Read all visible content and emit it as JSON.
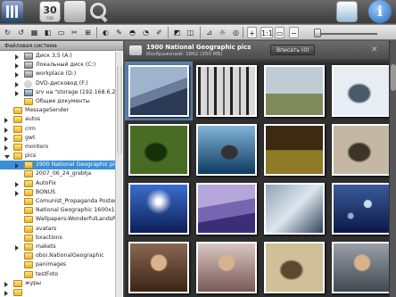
{
  "toolbar": {
    "calendar_day": "30",
    "calendar_month": "FEB",
    "info_glyph": "i",
    "buttons": [
      "↻",
      "↺",
      "▦",
      "◧",
      "▭",
      "✂",
      "⊞",
      "◐",
      "✎",
      "◓",
      "◔",
      "✐",
      "◩",
      "◫",
      "⊿",
      "☼",
      "◎",
      "+",
      "1:1",
      "▭",
      "−"
    ]
  },
  "left_panel": {
    "header": "Файловая система",
    "tree": [
      {
        "label": "Диск 3,5 (A:)",
        "icon": "drive",
        "level": 1,
        "expander": "closed"
      },
      {
        "label": "Локальный диск (C:)",
        "icon": "drive",
        "level": 1,
        "expander": "closed"
      },
      {
        "label": "workplace (D:)",
        "icon": "drive",
        "level": 1,
        "expander": "closed"
      },
      {
        "label": "DVD-дисковод (F:)",
        "icon": "cd",
        "level": 1,
        "expander": "closed"
      },
      {
        "label": "srv на \"storage (192.168.6.2)\"",
        "icon": "net",
        "level": 1,
        "expander": "closed"
      },
      {
        "label": "Общие документы",
        "icon": "folder",
        "level": 1,
        "expander": "none"
      },
      {
        "label": "MessageSender",
        "icon": "folder",
        "level": 0,
        "expander": "none"
      },
      {
        "label": "autos",
        "icon": "folder",
        "level": 0,
        "expander": "closed"
      },
      {
        "label": "crm",
        "icon": "folder",
        "level": 0,
        "expander": "closed"
      },
      {
        "label": "gwt",
        "icon": "folder",
        "level": 0,
        "expander": "closed"
      },
      {
        "label": "montero",
        "icon": "folder",
        "level": 0,
        "expander": "closed"
      },
      {
        "label": "pics",
        "icon": "folder",
        "level": 0,
        "expander": "open"
      },
      {
        "label": "1900 National Geographic pics",
        "icon": "folder",
        "level": 1,
        "expander": "closed",
        "selected": true
      },
      {
        "label": "2007_06_24_grebłja",
        "icon": "folder",
        "level": 1,
        "expander": "none"
      },
      {
        "label": "AutoFix",
        "icon": "folder",
        "level": 1,
        "expander": "closed"
      },
      {
        "label": "BONUS",
        "icon": "folder",
        "level": 1,
        "expander": "closed"
      },
      {
        "label": "Comunist_Propaganda Posters",
        "icon": "folder",
        "level": 1,
        "expander": "none"
      },
      {
        "label": "National Geographic 1600x1200",
        "icon": "folder",
        "level": 1,
        "expander": "none"
      },
      {
        "label": "Wallpapers-WonderfulLandsPlaces",
        "icon": "folder",
        "level": 1,
        "expander": "none"
      },
      {
        "label": "avatars",
        "icon": "folder",
        "level": 1,
        "expander": "none"
      },
      {
        "label": "bxactions",
        "icon": "folder",
        "level": 1,
        "expander": "none"
      },
      {
        "label": "makets",
        "icon": "folder",
        "level": 1,
        "expander": "closed"
      },
      {
        "label": "oboi.NationalGeographic",
        "icon": "folder",
        "level": 1,
        "expander": "none"
      },
      {
        "label": "panimages",
        "icon": "folder",
        "level": 1,
        "expander": "none"
      },
      {
        "label": "testFoto",
        "icon": "folder",
        "level": 1,
        "expander": "none"
      },
      {
        "label": "журы",
        "icon": "folder",
        "level": 0,
        "expander": "closed"
      },
      {
        "label": "",
        "icon": "folder",
        "level": 0,
        "expander": "closed"
      }
    ]
  },
  "main": {
    "title": "1900 National Geographic pics",
    "subtitle": "Изображений: 1862 (350 МБ)",
    "fit_button": "Вписать (0)",
    "close_glyph": "✕",
    "thumbnails": [
      {
        "colors": [
          "#9db4cc",
          "#2c3a55"
        ],
        "style": "mountains",
        "selected": true
      },
      {
        "colors": [
          "#d8d8d8",
          "#3c3c3c"
        ],
        "style": "trees"
      },
      {
        "colors": [
          "#c0ccd4",
          "#7e8a5a"
        ],
        "style": "field"
      },
      {
        "colors": [
          "#e7edf2",
          "#4a5a6a"
        ],
        "style": "figure"
      },
      {
        "colors": [
          "#486c24",
          "#183008"
        ],
        "style": "figure"
      },
      {
        "colors": [
          "#82b4d8",
          "#0e3a60"
        ],
        "style": "island"
      },
      {
        "colors": [
          "#3d2a12",
          "#8f7a26"
        ],
        "style": "dancers"
      },
      {
        "colors": [
          "#c4b8a4",
          "#3e3429"
        ],
        "style": "figure"
      },
      {
        "colors": [
          "#3a6ecc",
          "#0d1f58"
        ],
        "style": "tree"
      },
      {
        "colors": [
          "#b4a6d8",
          "#3b2e76"
        ],
        "style": "dunes"
      },
      {
        "colors": [
          "#8fa2b4",
          "#30455a"
        ],
        "style": "snow"
      },
      {
        "colors": [
          "#3b5a9a",
          "#0a1a48"
        ],
        "style": "bubbles"
      },
      {
        "colors": [
          "#8a6850",
          "#3c2416"
        ],
        "style": "portrait"
      },
      {
        "colors": [
          "#d8c8c0",
          "#7a5858"
        ],
        "style": "portrait"
      },
      {
        "colors": [
          "#d0c098",
          "#5a4830"
        ],
        "style": "figure"
      },
      {
        "colors": [
          "#9aa0a8",
          "#404850"
        ],
        "style": "portrait"
      }
    ]
  }
}
